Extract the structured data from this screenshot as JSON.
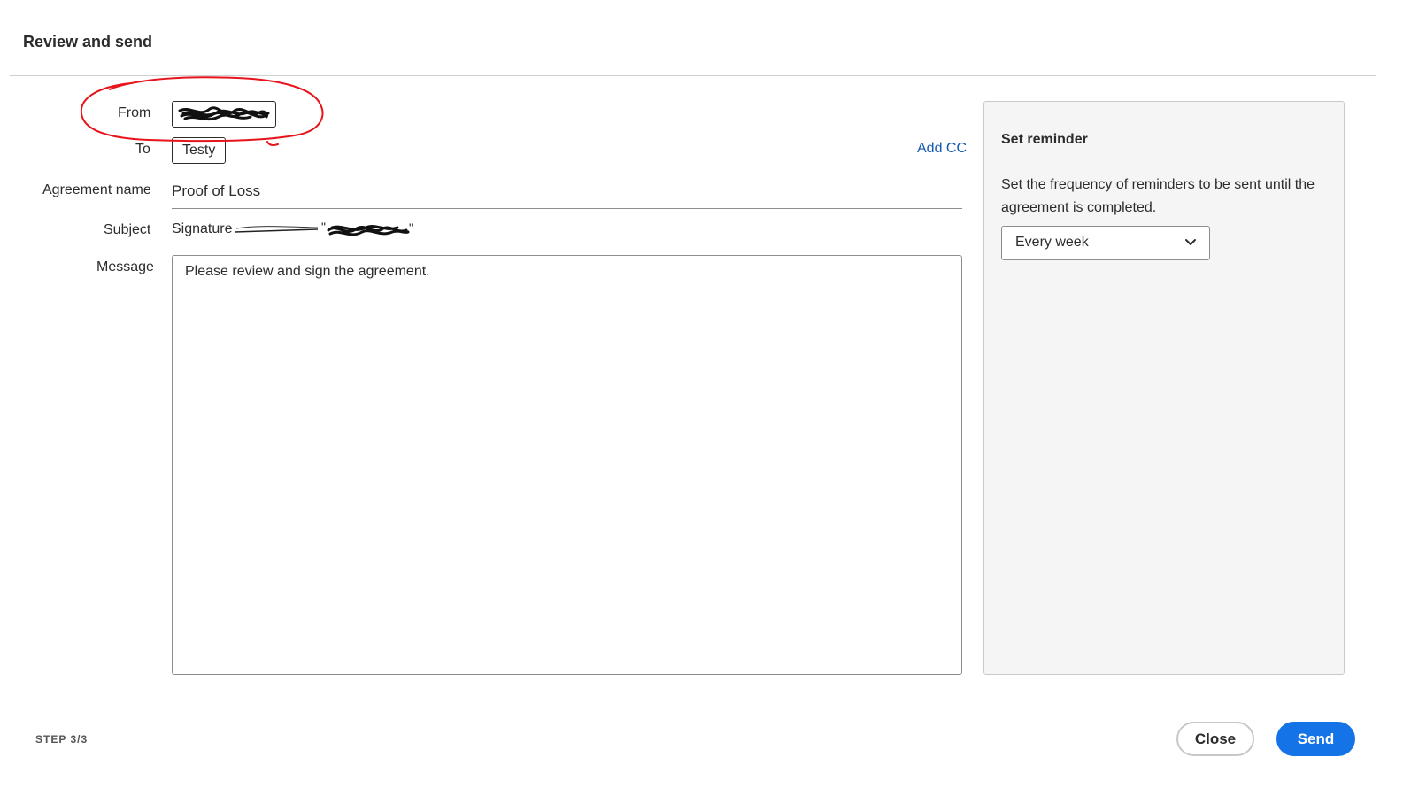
{
  "dialog": {
    "title": "Review and send"
  },
  "form": {
    "from_label": "From",
    "to_label": "To",
    "to_value": "Testy",
    "add_cc": "Add CC",
    "agreement_name_label": "Agreement name",
    "agreement_name_value": "Proof of Loss",
    "subject_label": "Subject",
    "subject_value": "Signature",
    "message_label": "Message",
    "message_value": "Please review and sign the agreement."
  },
  "reminder": {
    "title": "Set reminder",
    "description": "Set the frequency of reminders to be sent until the agreement is completed.",
    "selected": "Every week"
  },
  "footer": {
    "step": "STEP 3/3",
    "close_label": "Close",
    "send_label": "Send"
  },
  "colors": {
    "accent": "#1473e6",
    "link": "#1358b5",
    "annotation": "#e8141b"
  },
  "icons": {
    "select": "chevron-down-icon"
  }
}
